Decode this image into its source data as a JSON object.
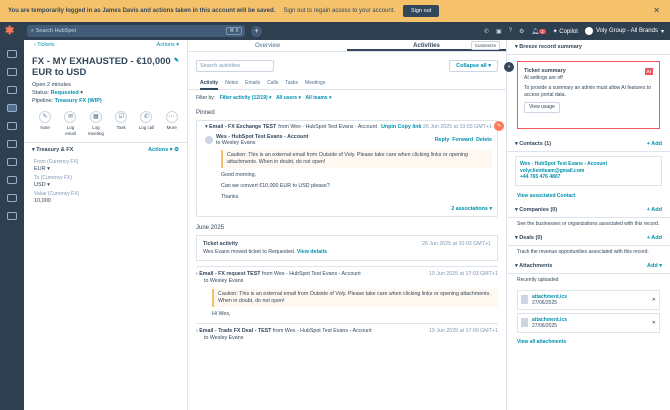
{
  "banner": {
    "message": "You are temporarily logged in as James Davis and actions taken in this account will be saved.",
    "sub": "Sign out to regain access to your account.",
    "signout": "Sign out"
  },
  "topnav": {
    "search_placeholder": "Search HubSpot",
    "kbd": "⌘ K",
    "copilot": "Copilot",
    "account": "Voly Group - All Brands",
    "notif_count": "1"
  },
  "left": {
    "back": "Tickets",
    "actions": "Actions",
    "title": "FX - MY EXHAUSTED - €10,000 EUR to USD",
    "open": "Open 2 minutes",
    "status_label": "Status:",
    "status": "Requested",
    "pipeline_label": "Pipeline:",
    "pipeline": "Treasury FX (WIP)",
    "activity_buttons": [
      "Note",
      "Log email",
      "Log meeting",
      "Task",
      "Log call",
      "More"
    ],
    "section": "Treasury & FX",
    "section_actions": "Actions",
    "props": [
      {
        "label": "From (Currency FX)",
        "value": "EUR"
      },
      {
        "label": "To (Currency FX)",
        "value": "USD"
      },
      {
        "label": "Value (Currency FX)",
        "value": "10,000"
      }
    ]
  },
  "center": {
    "tabs": [
      "Overview",
      "Activities"
    ],
    "customize": "Customize",
    "search": "Search activities",
    "collapse": "Collapse all",
    "subtabs": [
      "Activity",
      "Notes",
      "Emails",
      "Calls",
      "Tasks",
      "Meetings"
    ],
    "filter_label": "Filter by:",
    "filter1": "Filter activity (12/19)",
    "filter2": "All users",
    "filter3": "All teams",
    "pinned": "Pinned",
    "email1": {
      "title": "Email - FX Exchange TEST",
      "from_text": "from Wes - HubSpot Test Evans - Account",
      "unpin": "Unpin",
      "copy": "Copy link",
      "date": "26 Jun 2025 at 10:03 GMT+1",
      "sender": "Wes - HubSpot Test Evans - Account",
      "to": "to Wesley Evans",
      "reply": "Reply",
      "forward": "Forward",
      "delete": "Delete",
      "caution": "Caution: This is an external email from Outside of Voly. Please take care when clicking links or opening attachments. When in doubt, do not open!",
      "body1": "Good morning,",
      "body2": "Can we convert €10,000 EUR to USD please?",
      "body3": "Thanks",
      "assoc": "2 associations"
    },
    "month": "June 2025",
    "ticket": {
      "title": "Ticket activity",
      "date": "26 Jun 2025 at 10:03 GMT+1",
      "text": "Wes Evans moved ticket to Requested.",
      "link": "View details"
    },
    "email2": {
      "title": "Email - FX request TEST",
      "from": "from Wes - HubSpot Test Evans - Account",
      "date": "19 Jun 2025 at 17:03 GMT+1",
      "to": "to Wesley Evans",
      "caution": "Caution: This is an external email from Outside of Voly. Please take care when clicking links or opening attachments. When in doubt, do not open!",
      "body": "Hi Wes,"
    },
    "email3": {
      "title": "Email - Trade FX Deal - TEST",
      "from": "from Wes - HubSpot Test Evans - Account",
      "date": "19 Jun 2025 at 17:00 GMT+1",
      "to": "to Wesley Evans"
    }
  },
  "right": {
    "breeze": "Breeze record summary",
    "summary_title": "Ticket summary",
    "tag": "AI",
    "summary_text1": "AI settings are off",
    "summary_text2": "To provide a summary an admin must allow AI features to access portal data.",
    "view_usage": "View usage",
    "contacts": "Contacts (1)",
    "add": "+ Add",
    "contact_name": "Wes - HubSpot Test Evans - Account",
    "contact_email": "volyclientteam@gmail.com",
    "contact_phone": "+44 765 476 4807",
    "view_contact": "View associated Contact",
    "companies": "Companies (0)",
    "companies_text": "See the businesses or organizations associated with this record.",
    "deals": "Deals (0)",
    "deals_text": "Track the revenue opportunities associated with this record.",
    "attachments": "Attachments",
    "att_add": "Add",
    "recent": "Recently uploaded",
    "files": [
      {
        "name": "attachment.ics",
        "date": "27/06/2025"
      },
      {
        "name": "attachment.ics",
        "date": "27/06/2025"
      }
    ],
    "view_att": "View all attachments"
  }
}
